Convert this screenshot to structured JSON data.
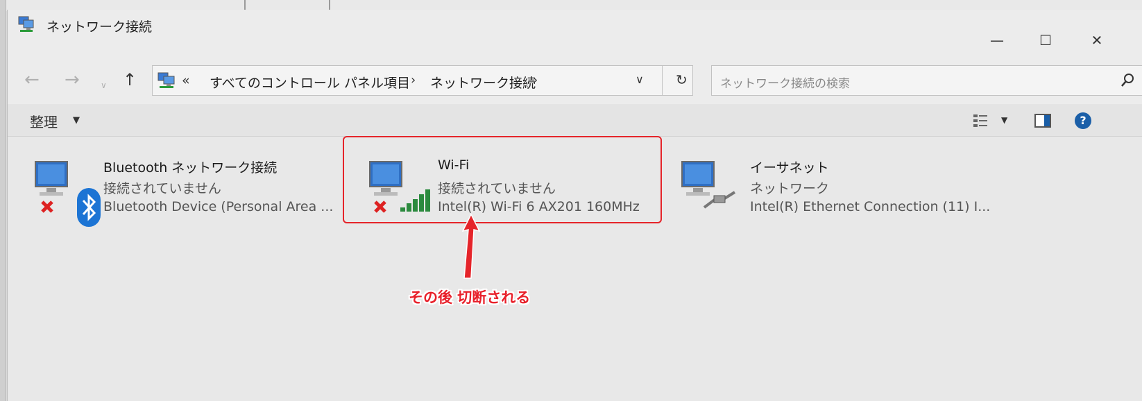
{
  "window": {
    "title": "ネットワーク接続",
    "controls": {
      "minimize": "—",
      "maximize": "☐",
      "close": "✕"
    }
  },
  "address": {
    "overflow": "«",
    "crumbs": [
      "すべてのコントロール パネル項目",
      "ネットワーク接続"
    ],
    "separator": "›"
  },
  "search": {
    "placeholder": "ネットワーク接続の検索"
  },
  "toolbar": {
    "organize_label": "整理",
    "caret": "▼"
  },
  "connections": [
    {
      "name": "Bluetooth ネットワーク接続",
      "status": "接続されていません",
      "device": "Bluetooth Device (Personal Area ...",
      "icon": "bluetooth-icon"
    },
    {
      "name": "Wi-Fi",
      "status": "接続されていません",
      "device": "Intel(R) Wi-Fi 6 AX201 160MHz",
      "icon": "wifi-signal-icon"
    },
    {
      "name": "イーサネット",
      "status": "ネットワーク",
      "device": "Intel(R) Ethernet Connection (11) I...",
      "icon": "ethernet-cable-icon"
    }
  ],
  "annotation": {
    "text": "その後  切断される",
    "color": "#e5242a"
  }
}
